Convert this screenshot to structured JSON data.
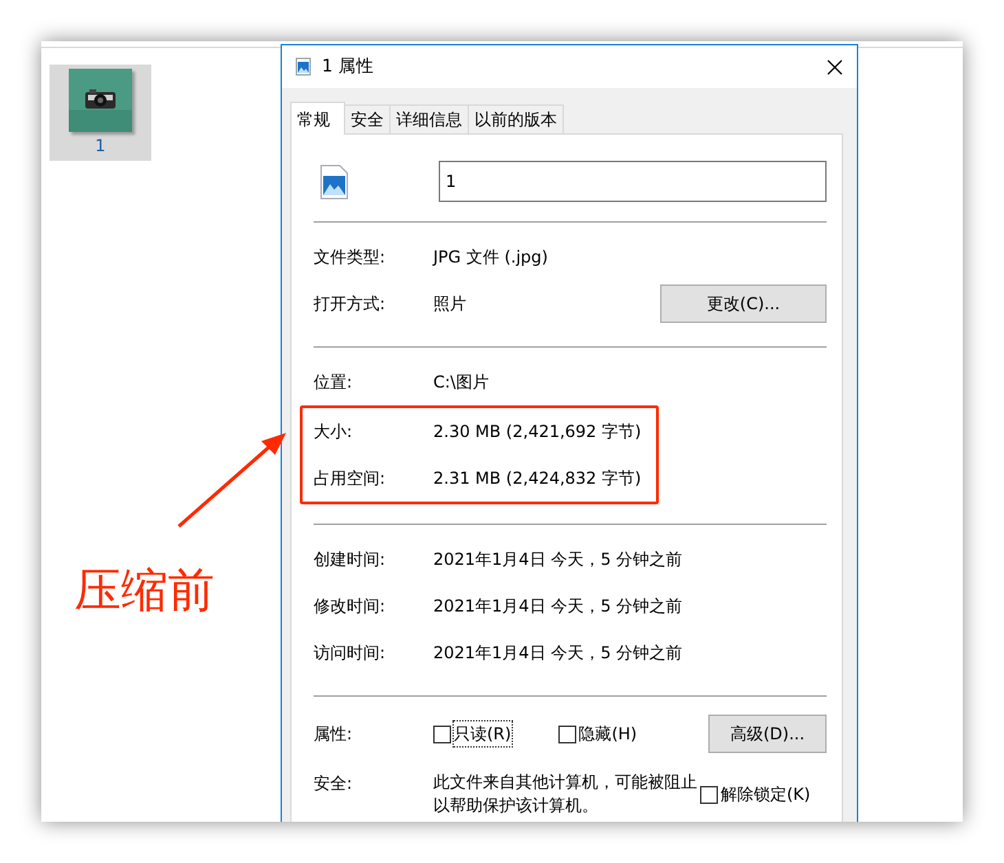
{
  "explorer": {
    "items": [
      {
        "label": "1",
        "selected": true,
        "kind": "picture"
      }
    ]
  },
  "dialog": {
    "title": "1 属性",
    "tabs": [
      {
        "label": "常规",
        "selected": true
      },
      {
        "label": "安全",
        "selected": false
      },
      {
        "label": "详细信息",
        "selected": false
      },
      {
        "label": "以前的版本",
        "selected": false
      }
    ],
    "file_name": "1",
    "sections": [
      [
        {
          "label": "文件类型:",
          "value": "JPG 文件 (.jpg)",
          "highlighted": false
        },
        {
          "label": "打开方式:",
          "value": "照片",
          "button": "更改(C)...",
          "highlighted": false
        }
      ],
      [
        {
          "label": "位置:",
          "value": "C:\\图片",
          "highlighted": false
        },
        {
          "label": "大小:",
          "value": "2.30 MB (2,421,692 字节)",
          "highlighted": true
        },
        {
          "label": "占用空间:",
          "value": "2.31 MB (2,424,832 字节)",
          "highlighted": true
        }
      ],
      [
        {
          "label": "创建时间:",
          "value": "2021年1月4日 今天，5 分钟之前",
          "highlighted": false
        },
        {
          "label": "修改时间:",
          "value": "2021年1月4日 今天，5 分钟之前",
          "highlighted": false
        },
        {
          "label": "访问时间:",
          "value": "2021年1月4日 今天，5 分钟之前",
          "highlighted": false
        }
      ]
    ],
    "attributes": {
      "label": "属性:",
      "checkboxes": [
        {
          "label": "只读(R)",
          "checked": false,
          "focused": true
        },
        {
          "label": "隐藏(H)",
          "checked": false,
          "focused": false
        }
      ],
      "button": "高级(D)..."
    },
    "security": {
      "label": "安全:",
      "text": "此文件来自其他计算机，可能被阻止以帮助保护该计算机。",
      "unblock": {
        "label": "解除锁定(K)",
        "checked": false
      }
    }
  },
  "annotation": {
    "text": "压缩前",
    "color": "#ff2a00"
  }
}
